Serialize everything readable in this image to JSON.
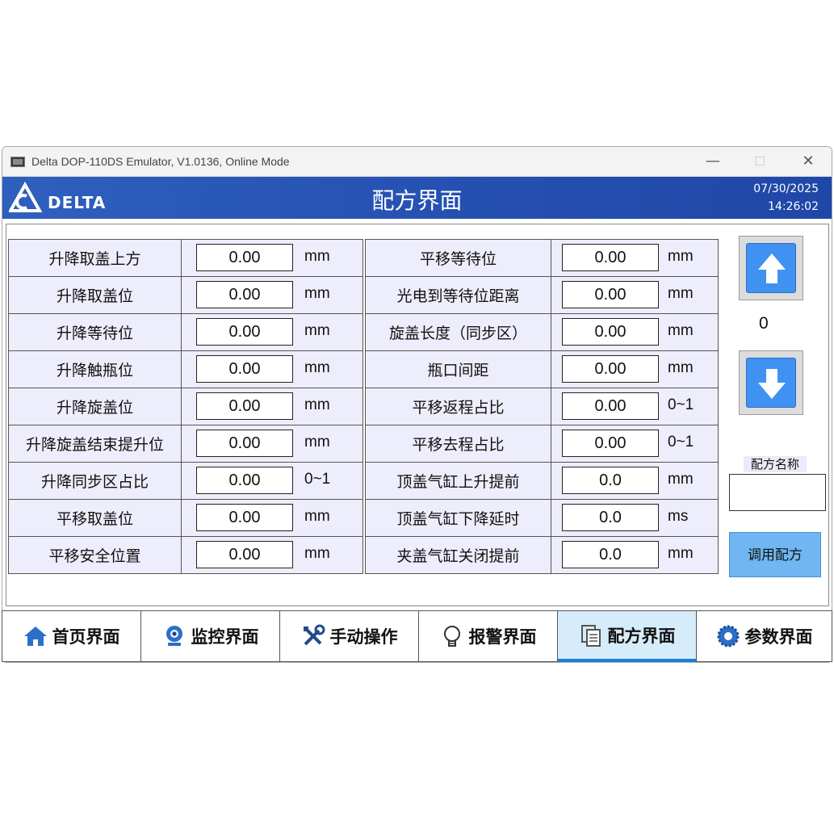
{
  "window": {
    "title": "Delta DOP-110DS Emulator, V1.0136, Online Mode",
    "minimize_label": "—",
    "maximize_label": "☐",
    "close_label": "✕"
  },
  "header": {
    "logo_text": "DELTA",
    "page_title": "配方界面",
    "date": "07/30/2025",
    "time": "14:26:02"
  },
  "left_params": [
    {
      "label": "升降取盖上方",
      "value": "0.00",
      "unit": "mm"
    },
    {
      "label": "升降取盖位",
      "value": "0.00",
      "unit": "mm"
    },
    {
      "label": "升降等待位",
      "value": "0.00",
      "unit": "mm"
    },
    {
      "label": "升降触瓶位",
      "value": "0.00",
      "unit": "mm"
    },
    {
      "label": "升降旋盖位",
      "value": "0.00",
      "unit": "mm"
    },
    {
      "label": "升降旋盖结束提升位",
      "value": "0.00",
      "unit": "mm"
    },
    {
      "label": "升降同步区占比",
      "value": "0.00",
      "unit": "0~1"
    },
    {
      "label": "平移取盖位",
      "value": "0.00",
      "unit": "mm"
    },
    {
      "label": "平移安全位置",
      "value": "0.00",
      "unit": "mm"
    }
  ],
  "right_params": [
    {
      "label": "平移等待位",
      "value": "0.00",
      "unit": "mm"
    },
    {
      "label": "光电到等待位距离",
      "value": "0.00",
      "unit": "mm"
    },
    {
      "label": "旋盖长度（同步区）",
      "value": "0.00",
      "unit": "mm"
    },
    {
      "label": "瓶口间距",
      "value": "0.00",
      "unit": "mm"
    },
    {
      "label": "平移返程占比",
      "value": "0.00",
      "unit": "0~1"
    },
    {
      "label": "平移去程占比",
      "value": "0.00",
      "unit": "0~1"
    },
    {
      "label": "顶盖气缸上升提前",
      "value": "0.0",
      "unit": "mm"
    },
    {
      "label": "顶盖气缸下降延时",
      "value": "0.0",
      "unit": "ms"
    },
    {
      "label": "夹盖气缸关闭提前",
      "value": "0.0",
      "unit": "mm"
    }
  ],
  "recipe": {
    "index": "0",
    "name_label": "配方名称",
    "name_value": "",
    "load_button": "调用配方",
    "up_icon": "arrow-up-icon",
    "down_icon": "arrow-down-icon"
  },
  "nav": [
    {
      "label": "首页界面",
      "icon": "home-icon"
    },
    {
      "label": "监控界面",
      "icon": "webcam-icon"
    },
    {
      "label": "手动操作",
      "icon": "tools-icon"
    },
    {
      "label": "报警界面",
      "icon": "lightbulb-icon"
    },
    {
      "label": "配方界面",
      "icon": "document-icon"
    },
    {
      "label": "参数界面",
      "icon": "gear-icon"
    }
  ],
  "colors": {
    "header_blue": "#2a55b5",
    "cell_bg": "#ededfb",
    "button_blue": "#3f92f2",
    "load_button_bg": "#6fb6f2",
    "active_tab_bg": "#d6ecfb"
  }
}
